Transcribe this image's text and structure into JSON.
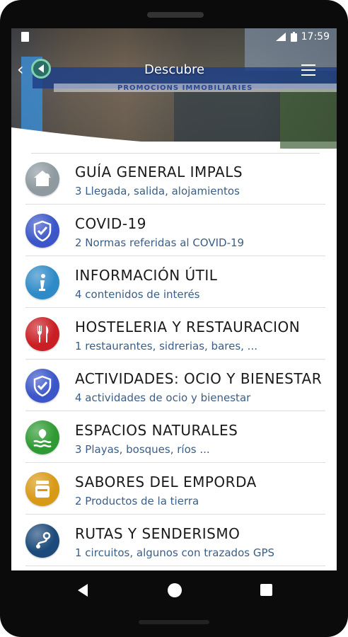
{
  "statusbar": {
    "time": "17:59"
  },
  "appbar": {
    "title": "Descubre"
  },
  "hero": {
    "banner_text": "PROMOCIONS IMMOBILIARIES"
  },
  "items": [
    {
      "title": "GUÍA GENERAL IMPALS",
      "subtitle": "3 Llegada, salida, alojamientos",
      "icon": "house-icon",
      "color": "#8e9aa0"
    },
    {
      "title": "COVID-19",
      "subtitle": "2 Normas referidas al COVID-19",
      "icon": "shield-check-icon",
      "color": "#3a56c8"
    },
    {
      "title": "INFORMACIÓN ÚTIL",
      "subtitle": "4 contenidos de interés",
      "icon": "info-icon",
      "color": "#2f8bc8"
    },
    {
      "title": "HOSTELERIA Y RESTAURACION",
      "subtitle": "1 restaurantes, sidrerias, bares, ...",
      "icon": "fork-knife-icon",
      "color": "#c91f24"
    },
    {
      "title": "ACTIVIDADES: OCIO Y BIENESTAR",
      "subtitle": "4 actividades de ocio y bienestar",
      "icon": "shield-check-icon",
      "color": "#3a56c8"
    },
    {
      "title": "ESPACIOS NATURALES",
      "subtitle": "3 Playas, bosques, ríos ...",
      "icon": "leaf-wave-icon",
      "color": "#2f9a33"
    },
    {
      "title": "SABORES DEL EMPORDA",
      "subtitle": "2 Productos de la tierra",
      "icon": "jar-icon",
      "color": "#d89a16"
    },
    {
      "title": "RUTAS Y SENDERISMO",
      "subtitle": "1 circuitos, algunos con trazados GPS",
      "icon": "route-icon",
      "color": "#1c4a7a"
    }
  ]
}
